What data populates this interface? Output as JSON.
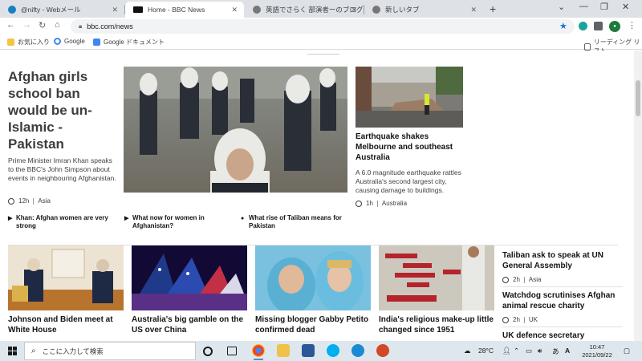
{
  "browser": {
    "tabs": [
      {
        "title": "@nifty - Webメール",
        "close": "✕"
      },
      {
        "title": "Home - BBC News",
        "close": "✕"
      },
      {
        "title": "英語でさらく 部演者ーのブログ",
        "close": "✕"
      },
      {
        "title": "新しいタブ",
        "close": "✕"
      }
    ],
    "new_tab": "+",
    "url": "bbc.com/news",
    "bookmarks": [
      {
        "label": "お気に入り"
      },
      {
        "label": "Google"
      },
      {
        "label": "Google ドキュメント"
      }
    ],
    "reading_list": "リーディング リスト"
  },
  "lead_story": {
    "headline": "Afghan girls school ban would be un-Islamic - Pakistan",
    "summary": "Prime Minister Imran Khan speaks to the BBC's John Simpson about events in neighbouring Afghanistan.",
    "time": "12h",
    "section": "Asia",
    "related": [
      "Khan: Afghan women are very strong",
      "What now for women in Afghanistan?",
      "What rise of Taliban means for Pakistan"
    ]
  },
  "second_story": {
    "headline": "Earthquake shakes Melbourne and southeast Australia",
    "summary": "A 6.0 magnitude earthquake rattles Australia's second largest city, causing damage to buildings.",
    "time": "1h",
    "section": "Australia"
  },
  "row_stories": [
    {
      "headline": "Johnson and Biden meet at White House"
    },
    {
      "headline": "Australia's big gamble on the US over China"
    },
    {
      "headline": "Missing blogger Gabby Petito confirmed dead"
    },
    {
      "headline": "India's religious make-up little changed since 1951"
    }
  ],
  "side_stories": [
    {
      "headline": "Taliban ask to speak at UN General Assembly",
      "time": "2h",
      "section": "Asia"
    },
    {
      "headline": "Watchdog scrutinises Afghan animal rescue charity",
      "time": "2h",
      "section": "UK"
    },
    {
      "headline": "UK defence secretary"
    }
  ],
  "taskbar": {
    "search_placeholder": "ここに入力して検索",
    "weather": "28°C",
    "time": "10:47",
    "date": "2021/09/22",
    "ime": "A"
  }
}
